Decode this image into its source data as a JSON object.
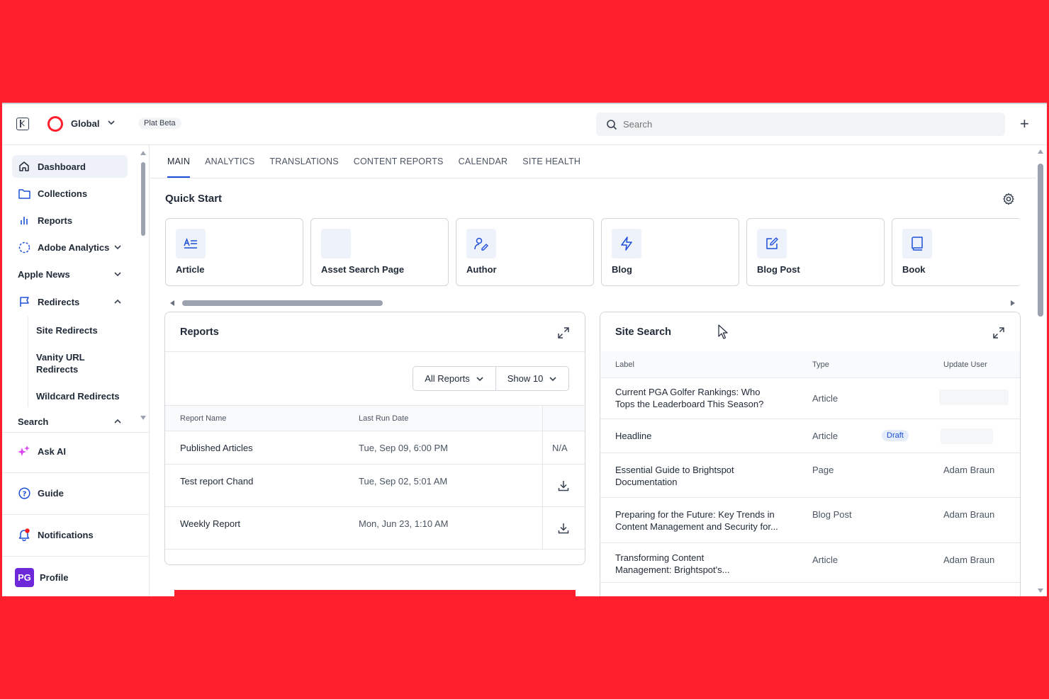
{
  "topbar": {
    "site_name": "Global",
    "beta_label": "Plat Beta",
    "search_placeholder": "Search"
  },
  "sidebar": {
    "items": {
      "dashboard": "Dashboard",
      "collections": "Collections",
      "reports": "Reports",
      "adobe_analytics": "Adobe Analytics",
      "apple_news": "Apple News",
      "redirects": "Redirects",
      "search": "Search",
      "ask_ai": "Ask AI",
      "guide": "Guide",
      "notifications": "Notifications",
      "profile": "Profile"
    },
    "redirect_sub_items": {
      "site": "Site Redirects",
      "vanity_line1": "Vanity URL",
      "vanity_line2": "Redirects",
      "wildcard": "Wildcard Redirects"
    },
    "avatar_initials": "PG"
  },
  "tabs": [
    "MAIN",
    "ANALYTICS",
    "TRANSLATIONS",
    "CONTENT REPORTS",
    "CALENDAR",
    "SITE HEALTH"
  ],
  "quick_start": {
    "title": "Quick Start",
    "cards": [
      "Article",
      "Asset Search Page",
      "Author",
      "Blog",
      "Blog Post",
      "Book"
    ]
  },
  "reports": {
    "title": "Reports",
    "filter_all": "All Reports",
    "filter_show": "Show 10",
    "columns": [
      "Report Name",
      "Last Run Date"
    ],
    "rows": [
      {
        "name": "Published Articles",
        "date": "Tue, Sep 09, 6:00 PM",
        "action": "N/A"
      },
      {
        "name": "Test report Chand",
        "date": "Tue, Sep 02, 5:01 AM",
        "action": ""
      },
      {
        "name": "Weekly Report",
        "date": "Mon, Jun 23, 1:10 AM",
        "action": ""
      }
    ]
  },
  "site_search": {
    "title": "Site Search",
    "columns": [
      "Label",
      "Type",
      "Update User"
    ],
    "rows": [
      {
        "label1": "Current PGA Golfer Rankings: Who",
        "label2": "Tops the Leaderboard This Season?",
        "type": "Article",
        "user": ""
      },
      {
        "label1": "Headline",
        "label2": "",
        "type": "Article",
        "badge": "Draft",
        "user": ""
      },
      {
        "label1": "Essential Guide to Brightspot",
        "label2": "Documentation",
        "type": "Page",
        "user": "Adam Braun"
      },
      {
        "label1": "Preparing for the Future: Key Trends in",
        "label2": "Content Management and Security for...",
        "type": "Blog Post",
        "user": "Adam Braun"
      },
      {
        "label1": "Transforming Content",
        "label2": "Management: Brightspot's...",
        "type": "Article",
        "user": "Adam Braun"
      }
    ]
  },
  "colors": {
    "brand": "#ff1f2d",
    "accent": "#1d4ed8",
    "avatar": "#6d28d9"
  }
}
